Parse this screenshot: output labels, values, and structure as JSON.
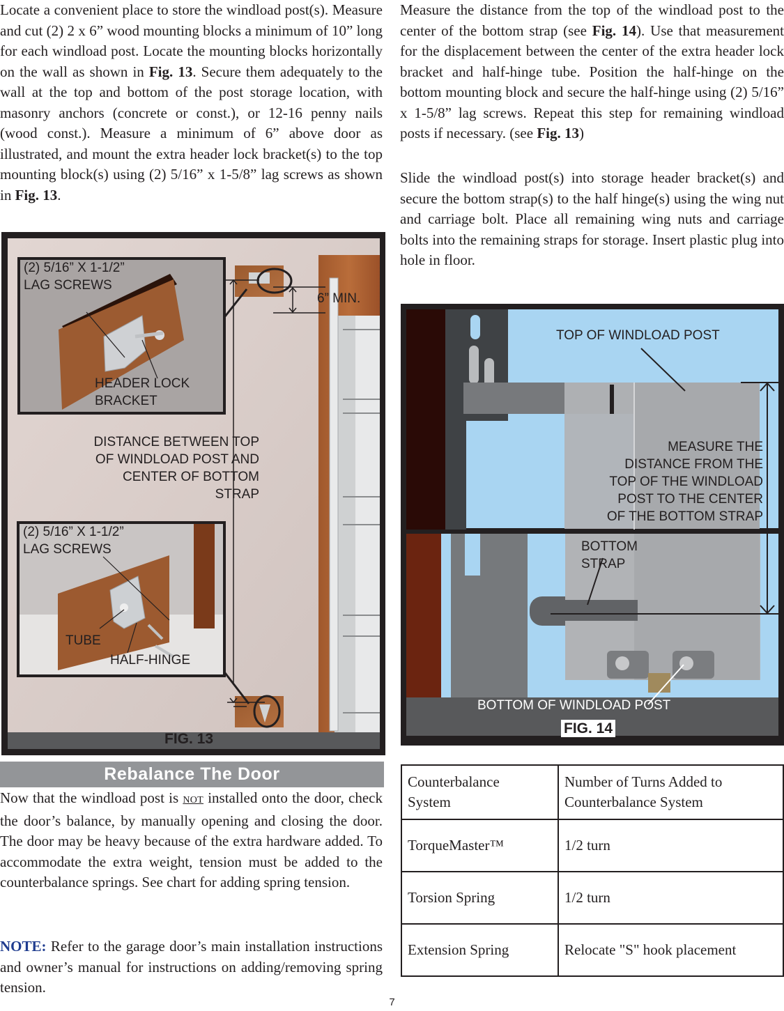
{
  "left_column": {
    "intro_paragraph": [
      {
        "text": "Locate a convenient place to store the windload post(s). Measure and cut (2) 2 x 6” wood mounting blocks a minimum of 10” long for each windload post.  Locate the mounting blocks horizontally on the wall as shown in "
      },
      {
        "text": "Fig. 13",
        "bold": true
      },
      {
        "text": ".  Secure them adequately to the wall at the top and bottom of the post storage location, with masonry anchors (concrete or const.), or 12-16 penny nails (wood const.).  Measure a minimum of 6” above door as illustrated, and mount the extra header lock bracket(s) to the top mounting block(s) using (2) 5/16” x 1-5/8” lag screws as shown in "
      },
      {
        "text": "Fig. 13",
        "bold": true
      },
      {
        "text": "."
      }
    ]
  },
  "right_column": {
    "measure_paragraph": [
      {
        "text": "Measure the distance from the top of the windload post to the center of the bottom strap (see "
      },
      {
        "text": "Fig. 14",
        "bold": true
      },
      {
        "text": ").  Use that measurement for the displacement between the center of the extra header lock bracket and half-hinge tube.  Position the half-hinge on the bottom mounting block and secure the half-hinge using (2) 5/16” x 1-5/8” lag screws.  Repeat this step for remaining windload posts if necessary.  (see "
      },
      {
        "text": "Fig. 13",
        "bold": true
      },
      {
        "text": ")"
      }
    ],
    "slide_paragraph": "Slide the windload post(s) into storage header bracket(s) and secure the bottom strap(s) to the half hinge(s) using the wing nut and carriage bolt.  Place all remaining wing nuts and carriage bolts into the remaining straps for storage. Insert plastic plug into hole in floor."
  },
  "fig13": {
    "caption": "FIG. 13",
    "top_inset_screws": "(2) 5/16” X 1-1/2”\nLAG SCREWS",
    "top_inset_bracket": "HEADER LOCK\nBRACKET",
    "six_min": "6” MIN.",
    "distance_label": "DISTANCE BETWEEN TOP\nOF WINDLOAD POST AND\nCENTER OF BOTTOM\nSTRAP",
    "bottom_inset_screws": "(2) 5/16” X 1-1/2”\nLAG SCREWS",
    "bottom_inset_tube": "TUBE",
    "bottom_inset_half_hinge": "HALF-HINGE"
  },
  "fig14": {
    "caption": "FIG. 14",
    "top_label": "TOP OF WINDLOAD POST",
    "measure_label": "MEASURE THE\nDISTANCE FROM THE\nTOP OF THE WINDLOAD\nPOST TO THE CENTER\nOF THE BOTTOM STRAP",
    "strap_label": "BOTTOM\nSTRAP",
    "bottom_label": "BOTTOM OF WINDLOAD POST"
  },
  "rebalance": {
    "header": "Rebalance The Door",
    "p1_before": "Now that the windload post is ",
    "p1_not": "NOT",
    "p1_after": " installed onto the door, check the door’s balance, by manually opening and closing the door.  The door may be heavy because of the extra hardware added.  To accommodate the extra weight, tension must be added to the counterbalance springs. See chart for adding spring tension.",
    "note_label": "NOTE:",
    "note_text": "  Refer to the garage door’s main installation instructions and owner’s manual for instructions on adding/removing spring tension."
  },
  "spring_table": {
    "headers": [
      "Counterbalance\nSystem",
      "Number of Turns Added to\nCounterbalance System"
    ],
    "rows": [
      [
        "TorqueMaster™",
        "1/2  turn"
      ],
      [
        "Torsion Spring",
        "1/2  turn"
      ],
      [
        "Extension Spring",
        "Relocate \"S\" hook placement"
      ]
    ]
  },
  "page_number": "7",
  "colors": {
    "note_blue": "#1f3c8f",
    "header_gray": "#939598",
    "fig14_sky": "#a9d5f2"
  }
}
